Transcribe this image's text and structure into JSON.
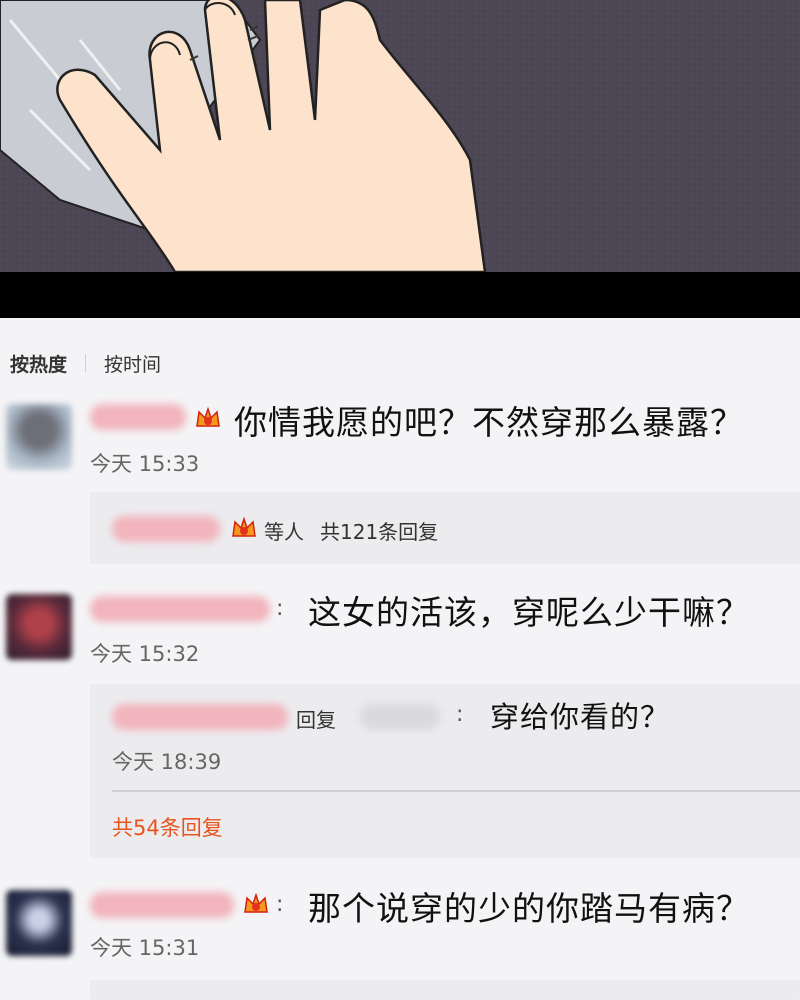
{
  "sort": {
    "hot_label": "按热度",
    "time_label": "按时间"
  },
  "comments": [
    {
      "text": "你情我愿的吧？不然穿那么暴露？",
      "time": "今天 15:33",
      "reply_summary": {
        "suffix": "等人",
        "count_text": "共121条回复"
      }
    },
    {
      "text": "这女的活该，穿呢么少干嘛？",
      "time": "今天 15:32",
      "reply": {
        "prefix": "回复",
        "text": "穿给你看的？",
        "time": "今天 18:39",
        "count_text": "共54条回复"
      }
    },
    {
      "text": "那个说穿的少的你踏马有病？",
      "time": "今天 15:31"
    }
  ],
  "colors": {
    "accent": "#e8541e",
    "background": "#f4f4f6",
    "reply_background": "#ececef"
  }
}
